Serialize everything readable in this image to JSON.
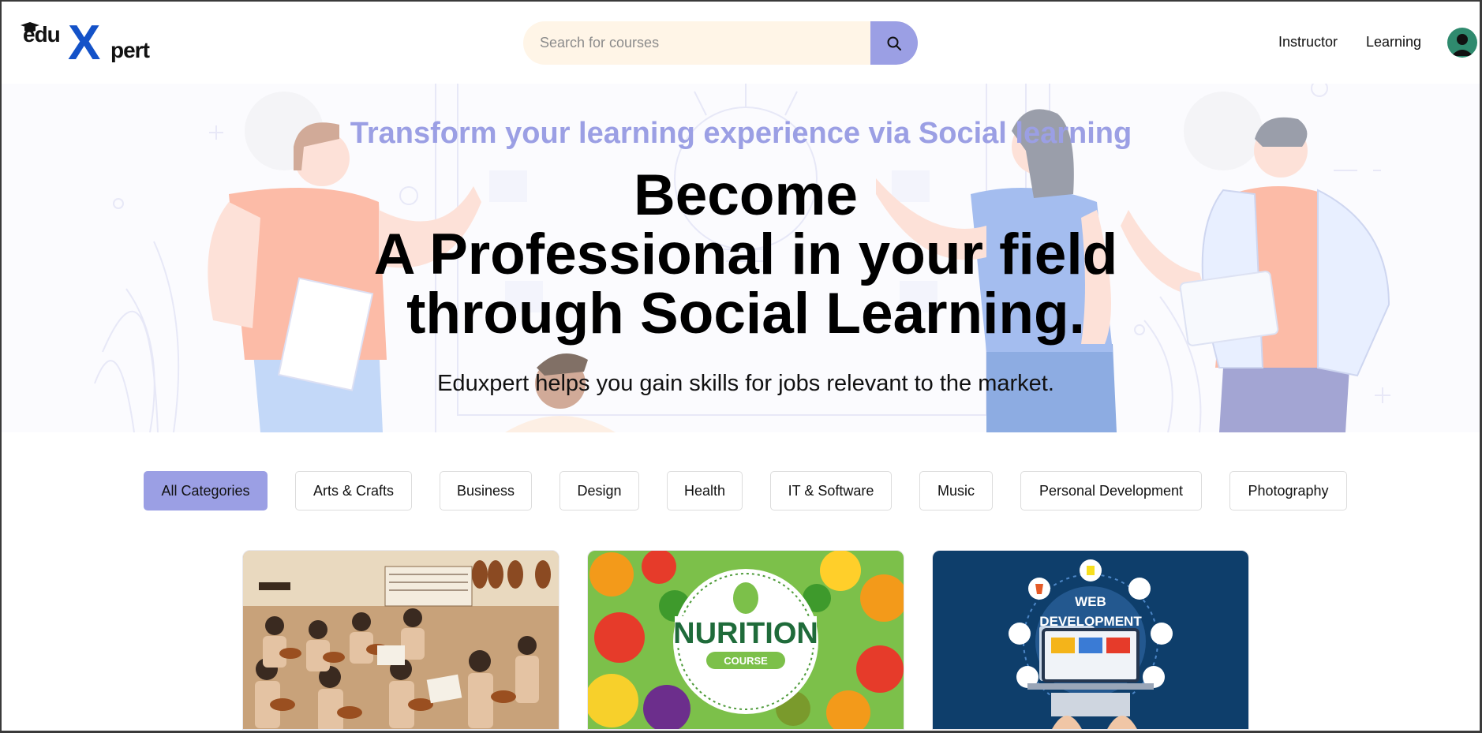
{
  "brand": {
    "logo_top": "edu",
    "logo_x": "X",
    "logo_bottom": "pert"
  },
  "search": {
    "placeholder": "Search for courses",
    "button_icon": "search-icon"
  },
  "nav": {
    "instructor": "Instructor",
    "learning": "Learning",
    "avatar_icon": "user-avatar-icon"
  },
  "hero": {
    "subtitle": "Transform your learning experience via Social learning",
    "title_line1": "Become",
    "title_line2": "A Professional in your field",
    "title_line3": "through Social Learning.",
    "description": "Eduxpert helps you gain skills for jobs relevant to the market."
  },
  "categories": [
    {
      "label": "All Categories",
      "active": true
    },
    {
      "label": "Arts & Crafts",
      "active": false
    },
    {
      "label": "Business",
      "active": false
    },
    {
      "label": "Design",
      "active": false
    },
    {
      "label": "Health",
      "active": false
    },
    {
      "label": "IT & Software",
      "active": false
    },
    {
      "label": "Music",
      "active": false
    },
    {
      "label": "Personal Development",
      "active": false
    },
    {
      "label": "Photography",
      "active": false
    }
  ],
  "courses": [
    {
      "image": "violin-orchestra-class-image"
    },
    {
      "image": "nutrition-course-image",
      "badge_title": "NURITION",
      "badge_sub": "COURSE"
    },
    {
      "image": "web-development-image",
      "title_line1": "WEB",
      "title_line2": "DEVELOPMENT"
    }
  ],
  "colors": {
    "accent": "#9b9fe4",
    "search_bg": "#fff5e7",
    "logo_blue": "#1452c8"
  }
}
